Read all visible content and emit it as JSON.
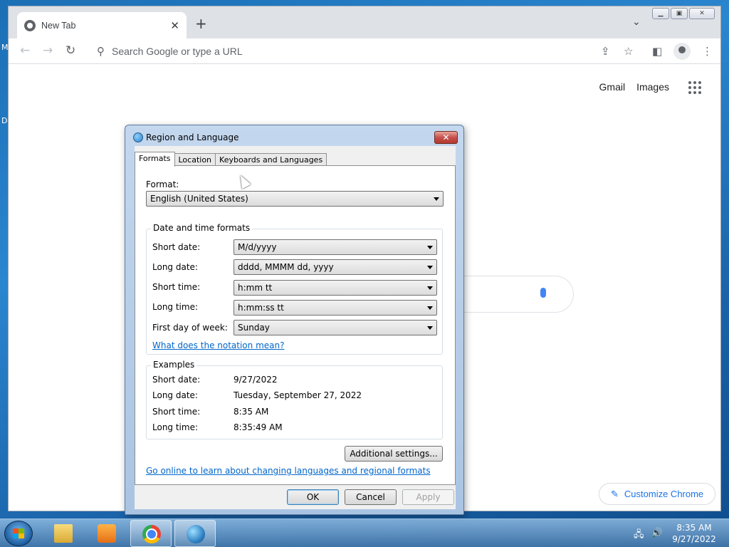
{
  "desktop": {
    "frag1": "M",
    "frag2": "D"
  },
  "browser": {
    "tab_title": "New Tab",
    "omnibox_placeholder": "Search Google or type a URL",
    "links": [
      "Gmail",
      "Images"
    ],
    "customize_label": "Customize Chrome"
  },
  "dialog": {
    "title": "Region and Language",
    "tabs": [
      "Formats",
      "Location",
      "Keyboards and Languages"
    ],
    "format_label": "Format:",
    "format_value": "English (United States)",
    "dt_group_title": "Date and time formats",
    "rows": [
      {
        "label": "Short date:",
        "value": "M/d/yyyy"
      },
      {
        "label": "Long date:",
        "value": "dddd, MMMM dd, yyyy"
      },
      {
        "label": "Short time:",
        "value": "h:mm tt"
      },
      {
        "label": "Long time:",
        "value": "h:mm:ss tt"
      },
      {
        "label": "First day of week:",
        "value": "Sunday"
      }
    ],
    "notation_link": "What does the notation mean?",
    "examples_title": "Examples",
    "examples": [
      {
        "label": "Short date:",
        "value": "9/27/2022"
      },
      {
        "label": "Long date:",
        "value": "Tuesday, September 27, 2022"
      },
      {
        "label": "Short time:",
        "value": "8:35 AM"
      },
      {
        "label": "Long time:",
        "value": "8:35:49 AM"
      }
    ],
    "additional_btn": "Additional settings...",
    "online_link": "Go online to learn about changing languages and regional formats",
    "ok": "OK",
    "cancel": "Cancel",
    "apply": "Apply"
  },
  "taskbar": {
    "time": "8:35 AM",
    "date": "9/27/2022"
  }
}
